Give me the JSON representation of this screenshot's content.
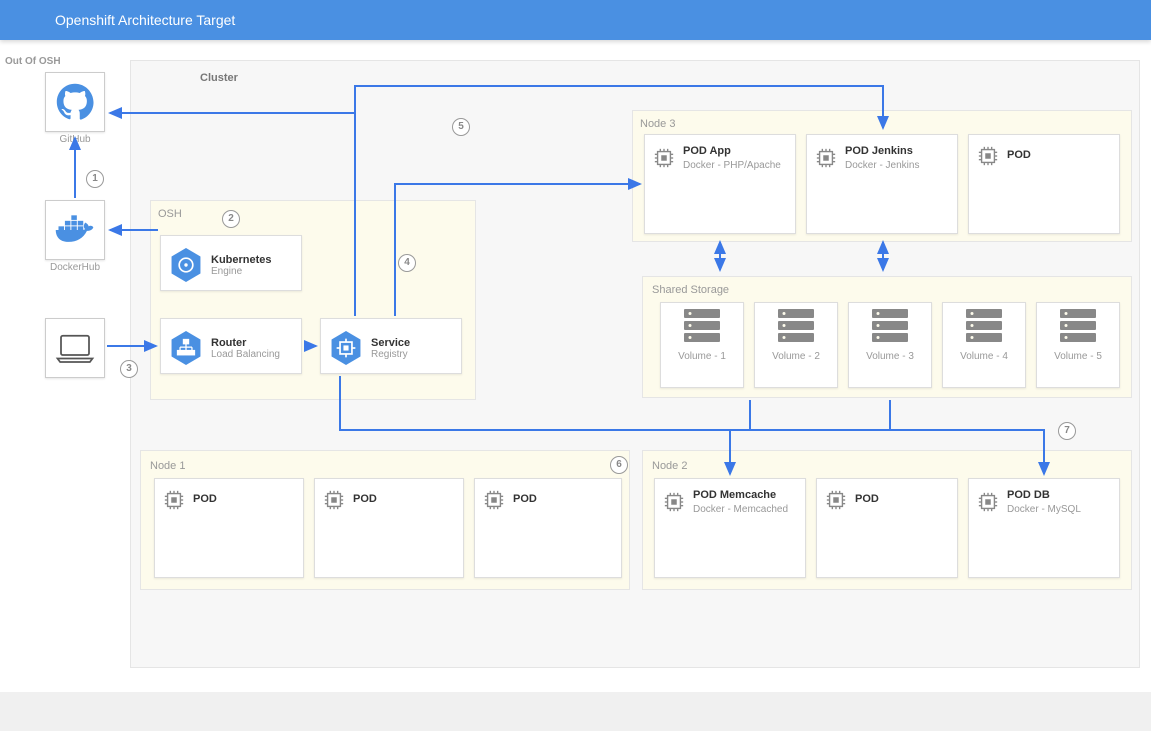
{
  "header": {
    "title": "Openshift Architecture Target"
  },
  "out_label": "Out Of OSH",
  "external": {
    "github": "GitHub",
    "dockerhub": "DockerHub"
  },
  "cluster": {
    "label": "Cluster",
    "osh": {
      "label": "OSH",
      "k8s": {
        "title": "Kubernetes",
        "sub": "Engine"
      },
      "router": {
        "title": "Router",
        "sub": "Load Balancing"
      },
      "service": {
        "title": "Service",
        "sub": "Registry"
      }
    },
    "node1": {
      "label": "Node 1",
      "pods": [
        {
          "title": "POD",
          "sub": ""
        },
        {
          "title": "POD",
          "sub": ""
        },
        {
          "title": "POD",
          "sub": ""
        }
      ]
    },
    "node2": {
      "label": "Node 2",
      "pods": [
        {
          "title": "POD Memcache",
          "sub": "Docker - Memcached"
        },
        {
          "title": "POD",
          "sub": ""
        },
        {
          "title": "POD DB",
          "sub": "Docker - MySQL"
        }
      ]
    },
    "node3": {
      "label": "Node 3",
      "pods": [
        {
          "title": "POD App",
          "sub": "Docker - PHP/Apache"
        },
        {
          "title": "POD Jenkins",
          "sub": "Docker - Jenkins"
        },
        {
          "title": "POD",
          "sub": ""
        }
      ]
    },
    "storage": {
      "label": "Shared Storage",
      "volumes": [
        "Volume - 1",
        "Volume - 2",
        "Volume - 3",
        "Volume - 4",
        "Volume - 5"
      ]
    }
  },
  "steps": [
    "1",
    "2",
    "3",
    "4",
    "5",
    "6",
    "7"
  ]
}
